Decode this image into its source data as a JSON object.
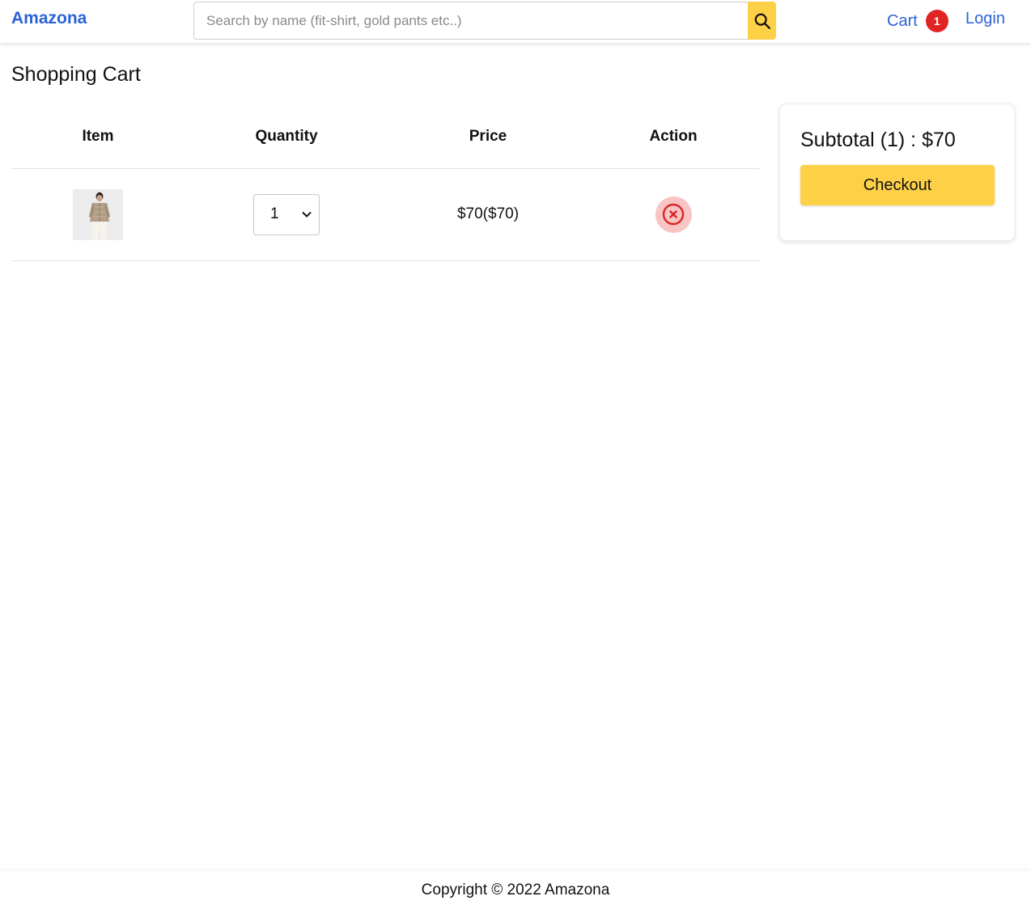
{
  "header": {
    "brand": "Amazona",
    "search": {
      "placeholder": "Search by name (fit-shirt, gold pants etc..)",
      "value": "",
      "button_icon": "search-icon"
    },
    "cart_label": "Cart",
    "cart_count": "1",
    "login_label": "Login"
  },
  "main": {
    "title": "Shopping Cart",
    "table": {
      "columns": [
        "Item",
        "Quantity",
        "Price",
        "Action"
      ],
      "rows": [
        {
          "image_icon": "product-photo",
          "quantity": "1",
          "price": "$70($70)",
          "action_icon": "remove-circle-icon"
        }
      ]
    }
  },
  "summary": {
    "subtotal": "Subtotal (1) : $70",
    "checkout_label": "Checkout"
  },
  "footer": {
    "copyright": "Copyright © 2022 Amazona"
  },
  "colors": {
    "brand": "#2b63d6",
    "accent": "#fdd048",
    "badge": "#e02424",
    "remove_bg": "#f8c4c4"
  }
}
